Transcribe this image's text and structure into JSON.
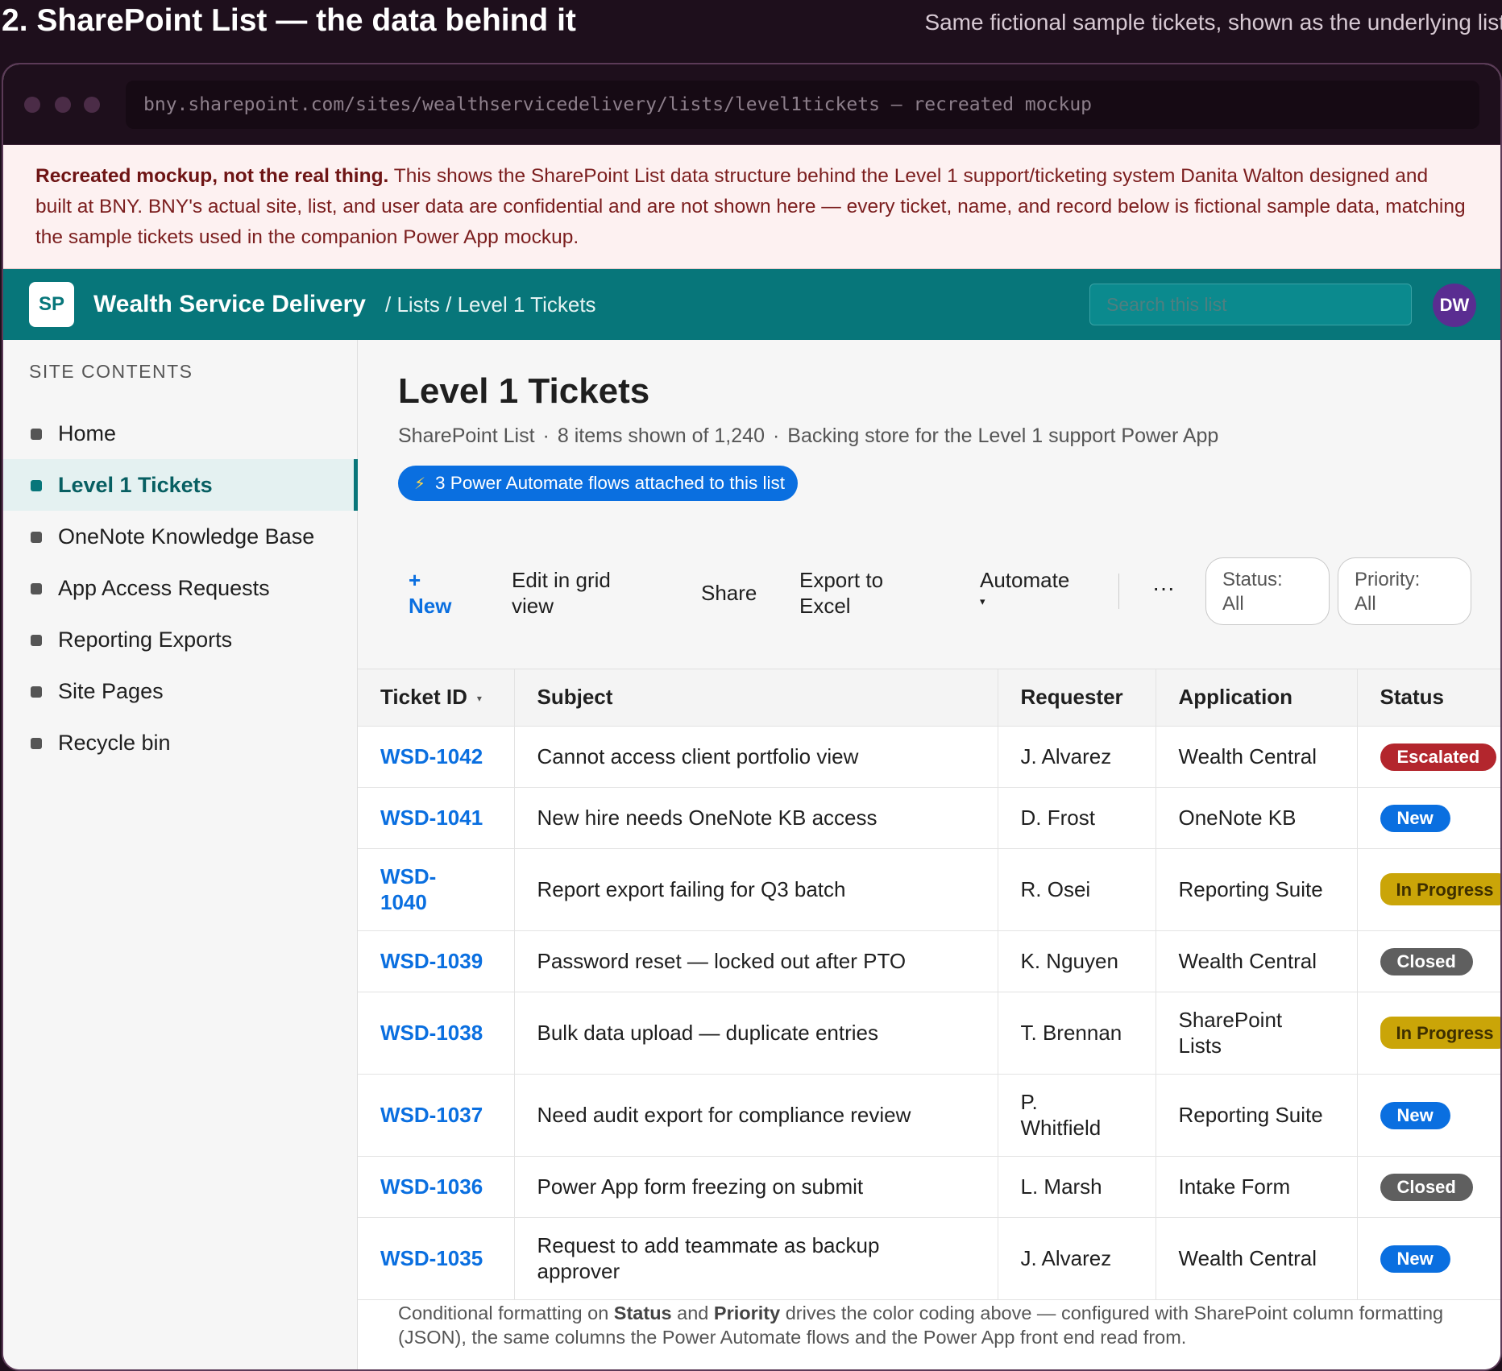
{
  "header": {
    "title": "2. SharePoint List — the data behind it",
    "subtitle": "Same fictional sample tickets, shown as the underlying list"
  },
  "browser": {
    "url": "bny.sharepoint.com/sites/wealthservicedelivery/lists/level1tickets — recreated mockup"
  },
  "disclaimer": {
    "lead": "Recreated mockup, not the real thing.",
    "body": " This shows the SharePoint List data structure behind the Level 1 support/ticketing system Danita Walton designed and built at BNY. BNY's actual site, list, and user data are confidential and are not shown here — every ticket, name, and record below is fictional sample data, matching the sample tickets used in the companion Power App mockup."
  },
  "suitebar": {
    "logo": "SP",
    "site_name": "Wealth Service Delivery",
    "breadcrumb": "/ Lists / Level 1 Tickets",
    "search_placeholder": "Search this list",
    "avatar": "DW"
  },
  "sidebar": {
    "heading": "SITE CONTENTS",
    "items": [
      {
        "label": "Home",
        "active": false
      },
      {
        "label": "Level 1 Tickets",
        "active": true
      },
      {
        "label": "OneNote Knowledge Base",
        "active": false
      },
      {
        "label": "App Access Requests",
        "active": false
      },
      {
        "label": "Reporting Exports",
        "active": false
      },
      {
        "label": "Site Pages",
        "active": false
      },
      {
        "label": "Recycle bin",
        "active": false
      }
    ]
  },
  "main": {
    "title": "Level 1 Tickets",
    "meta": {
      "type": "SharePoint List",
      "count": "8 items shown of 1,240",
      "description": "Backing store for the Level 1 support Power App",
      "separator": "·"
    },
    "flows_pill": {
      "icon": "⚡",
      "label": "3 Power Automate flows attached to this list"
    },
    "commands": {
      "new_plus": "+",
      "new": "New",
      "grid_line1": "Edit in grid",
      "grid_line2": "view",
      "share": "Share",
      "excel_line1": "Export to",
      "excel_line2": "Excel",
      "automate": "Automate",
      "automate_caret": "▾",
      "more": "···"
    },
    "filters": {
      "status_label": "Status:",
      "status_value": "All",
      "priority_label": "Priority:",
      "priority_value": "All"
    },
    "table": {
      "columns": [
        "Ticket ID",
        "Subject",
        "Requester",
        "Application",
        "Status"
      ],
      "sort_caret": "▾",
      "rows": [
        {
          "id": "WSD-1042",
          "subject": "Cannot access client portfolio view",
          "requester": "J. Alvarez",
          "application": "Wealth Central",
          "status": "Escalated"
        },
        {
          "id": "WSD-1041",
          "subject": "New hire needs OneNote KB access",
          "requester": "D. Frost",
          "application": "OneNote KB",
          "status": "New"
        },
        {
          "id": "WSD-1040",
          "subject": "Report export failing for Q3 batch",
          "requester": "R. Osei",
          "application": "Reporting Suite",
          "status": "In Progress"
        },
        {
          "id": "WSD-1039",
          "subject": "Password reset — locked out after PTO",
          "requester": "K. Nguyen",
          "application": "Wealth Central",
          "status": "Closed"
        },
        {
          "id": "WSD-1038",
          "subject": "Bulk data upload — duplicate entries",
          "requester": "T. Brennan",
          "application": "SharePoint Lists",
          "status": "In Progress"
        },
        {
          "id": "WSD-1037",
          "subject": "Need audit export for compliance review",
          "requester": "P. Whitfield",
          "application": "Reporting Suite",
          "status": "New"
        },
        {
          "id": "WSD-1036",
          "subject": "Power App form freezing on submit",
          "requester": "L. Marsh",
          "application": "Intake Form",
          "status": "Closed"
        },
        {
          "id": "WSD-1035",
          "subject": "Request to add teammate as backup approver",
          "requester": "J. Alvarez",
          "application": "Wealth Central",
          "status": "New"
        }
      ]
    },
    "footnote": {
      "p1": "Conditional formatting on ",
      "b1": "Status",
      "p2": " and ",
      "b2": "Priority",
      "p3": " drives the color coding above — configured with SharePoint column formatting (JSON), the same columns the Power Automate flows and the Power App front end read from."
    }
  },
  "colors": {
    "suitebar": "#07767a",
    "accent_blue": "#0a6fe0",
    "escalated": "#b3262d",
    "in_progress": "#caa508",
    "closed": "#5f5f5f",
    "avatar": "#5a2d91"
  }
}
